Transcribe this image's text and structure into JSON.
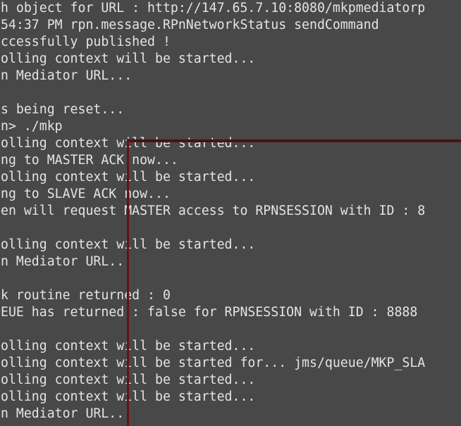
{
  "terminal": {
    "lines": [
      "h object for URL : http://147.65.7.10:8080/mkpmediatorp",
      "54:37 PM rpn.message.RPnNetworkStatus sendCommand",
      "ccessfully published !",
      "olling context will be started...",
      "n Mediator URL...",
      "",
      "s being reset...",
      "n> ./mkp",
      "olling context will be started...",
      "ng to MASTER ACK now...",
      "olling context will be started...",
      "ng to SLAVE ACK now...",
      "en will request MASTER access to RPNSESSION with ID : 8",
      "",
      "olling context will be started...",
      "n Mediator URL...",
      "",
      "k routine returned : 0",
      "EUE has returned : false for RPNSESSION with ID : 8888",
      "",
      "olling context will be started...",
      "olling context will be started for... jms/queue/MKP_SLA",
      "olling context will be started...",
      "olling context will be started...",
      "n Mediator URL..."
    ]
  },
  "colors": {
    "background": "#484848",
    "text": "#e4e4e4",
    "selection_border": "#6a1010"
  }
}
